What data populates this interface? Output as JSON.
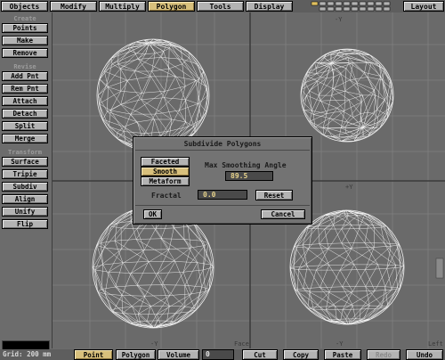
{
  "menu": {
    "tabs": [
      "Objects",
      "Modify",
      "Multiply",
      "Polygon",
      "Tools",
      "Display"
    ],
    "active_tab": "Polygon",
    "layout_label": "Layout"
  },
  "sidebar": {
    "create_header": "Create",
    "create": [
      "Points",
      "Make",
      "Remove"
    ],
    "revise_header": "Revise",
    "revise": [
      "Add Pnt",
      "Rem Pnt",
      "Attach",
      "Detach",
      "Split",
      "Merge"
    ],
    "transform_header": "Transform",
    "transform": [
      "Surface",
      "Tripie",
      "Subdiv",
      "Align",
      "Unify",
      "Flip"
    ]
  },
  "viewport_labels": {
    "top_right_axis": "-Y",
    "mid_left_axis": "-X",
    "mid_right_axis": "+Y",
    "bottom_left_axis": "-Y",
    "bottom_left_face": "Face",
    "bottom_right_axis": "-Y",
    "bottom_right_left": "Left"
  },
  "dialog": {
    "title": "Subdivide Polygons",
    "modes": [
      "Faceted",
      "Smooth",
      "Metaform"
    ],
    "selected_mode": "Smooth",
    "angle_label": "Max Smoothing Angle",
    "angle_value": "89.5",
    "fractal_label": "Fractal",
    "fractal_value": "0.0",
    "reset_label": "Reset",
    "ok_label": "OK",
    "cancel_label": "Cancel"
  },
  "statusbar": {
    "grid": "Grid: 200 mm",
    "select_modes": [
      "Point",
      "Polygon",
      "Volume"
    ],
    "active_mode": "Point",
    "count": "0",
    "actions": [
      "Cut",
      "Copy",
      "Paste",
      "Redo",
      "Undo"
    ],
    "disabled_action": "Redo"
  },
  "colors": {
    "accent": "#d8c07c",
    "wire": "#f2f2f2",
    "grid_line": "#808080",
    "button": "#b3b3b3"
  }
}
